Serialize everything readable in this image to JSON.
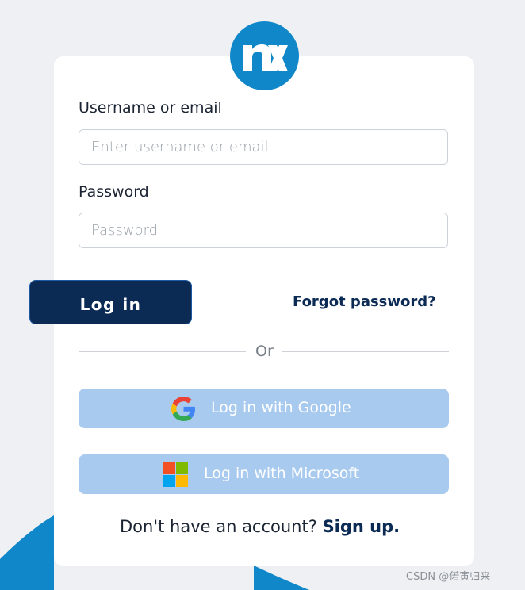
{
  "colors": {
    "brand": "#0f87c9",
    "primary_button": "#0b2b55",
    "social_button": "#a8caee",
    "background": "#eef0f4"
  },
  "logo": {
    "icon": "nx-logo-icon"
  },
  "form": {
    "username_label": "Username or email",
    "username_placeholder": "Enter username or email",
    "username_value": "",
    "password_label": "Password",
    "password_placeholder": "Password",
    "password_value": "",
    "login_button": "Log in",
    "forgot_password": "Forgot password?"
  },
  "divider": {
    "text": "Or"
  },
  "social": {
    "google_label": "Log in with Google",
    "google_icon": "google-icon",
    "microsoft_label": "Log in with Microsoft",
    "microsoft_icon": "microsoft-icon"
  },
  "signup": {
    "prompt": "Don't have an account?",
    "link": "Sign up."
  },
  "watermark": "CSDN @偌寅归来"
}
